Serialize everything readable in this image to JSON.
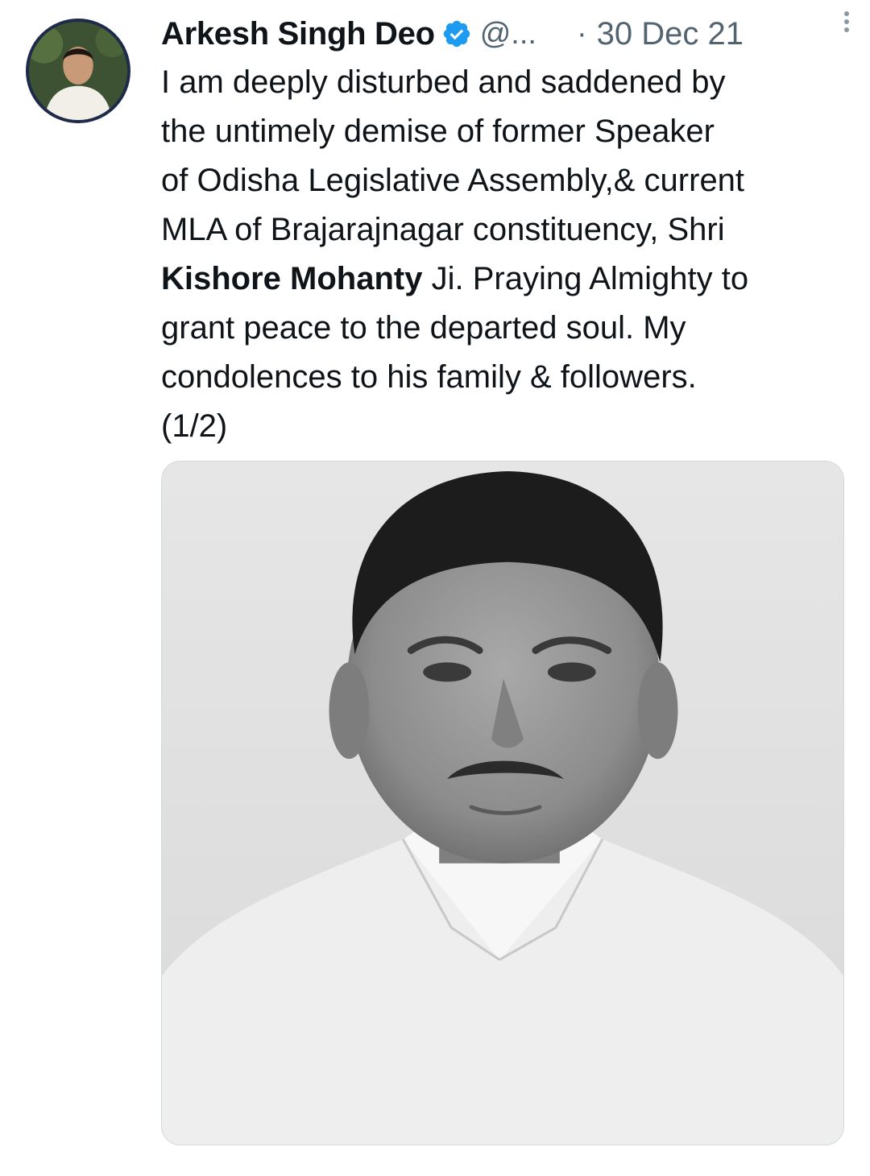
{
  "tweet": {
    "author_name": "Arkesh Singh Deo",
    "handle": "@...",
    "separator": "·",
    "date": "30 Dec 21",
    "text_lines": [
      "I am deeply disturbed and saddened by",
      "the untimely demise of former Speaker",
      "of Odisha Legislative Assembly,& current",
      "MLA of Brajarajnagar constituency, Shri"
    ],
    "highlight_name": "Kishore Mohanty",
    "line5_rest": " Ji. Praying Almighty to",
    "text_lines_end": [
      "grant peace to the departed soul. My",
      "condolences to his family & followers.",
      "(1/2)"
    ]
  },
  "icons": {
    "verified": "verified-badge-icon",
    "more": "more-options-icon"
  },
  "colors": {
    "text": "#0f1419",
    "secondary": "#536471",
    "verified": "#1d9bf0",
    "media_border": "#cfd9de"
  }
}
